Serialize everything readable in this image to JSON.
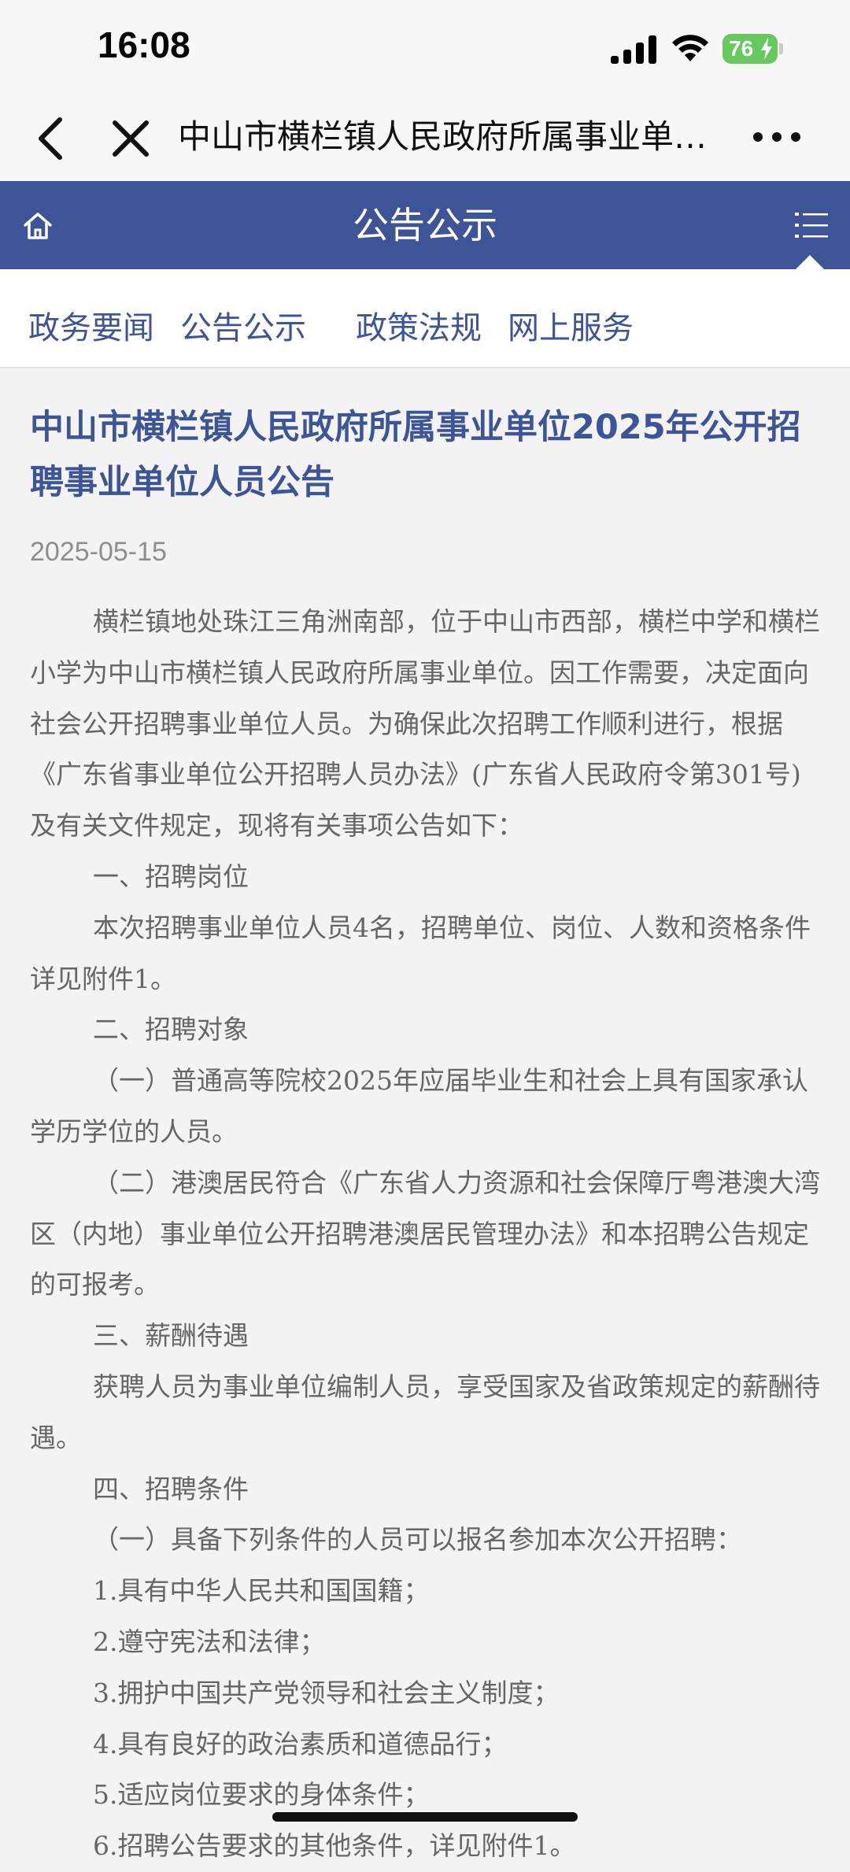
{
  "status_bar": {
    "time": "16:08",
    "battery": "76"
  },
  "browser": {
    "page_title": "中山市横栏镇人民政府所属事业单…"
  },
  "site_header": {
    "title": "公告公示"
  },
  "nav": {
    "items": [
      "政务要闻",
      "公告公示",
      "政策法规",
      "网上服务"
    ]
  },
  "article": {
    "title": "中山市横栏镇人民政府所属事业单位2025年公开招聘事业单位人员公告",
    "date": "2025-05-15",
    "paragraphs": [
      "横栏镇地处珠江三角洲南部，位于中山市西部，横栏中学和横栏小学为中山市横栏镇人民政府所属事业单位。因工作需要，决定面向社会公开招聘事业单位人员。为确保此次招聘工作顺利进行，根据《广东省事业单位公开招聘人员办法》(广东省人民政府令第301号)及有关文件规定，现将有关事项公告如下：",
      "一、招聘岗位",
      "本次招聘事业单位人员4名，招聘单位、岗位、人数和资格条件详见附件1。",
      "二、招聘对象",
      "（一）普通高等院校2025年应届毕业生和社会上具有国家承认学历学位的人员。",
      "（二）港澳居民符合《广东省人力资源和社会保障厅粤港澳大湾区（内地）事业单位公开招聘港澳居民管理办法》和本招聘公告规定的可报考。",
      "三、薪酬待遇",
      "获聘人员为事业单位编制人员，享受国家及省政策规定的薪酬待遇。",
      "四、招聘条件",
      "（一）具备下列条件的人员可以报名参加本次公开招聘：",
      "1.具有中华人民共和国国籍；",
      "2.遵守宪法和法律；",
      "3.拥护中国共产党领导和社会主义制度；",
      "4.具有良好的政治素质和道德品行；",
      "5.适应岗位要求的身体条件；",
      "6.招聘公告要求的其他条件，详见附件1。"
    ]
  }
}
